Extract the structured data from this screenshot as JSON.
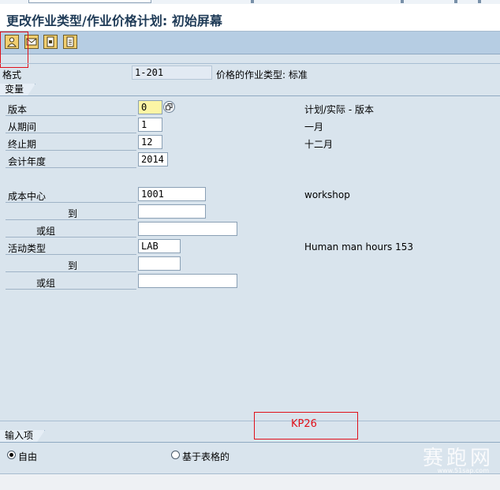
{
  "window": {
    "title": "更改作业类型/作业价格计划: 初始屏幕"
  },
  "toolbar": {
    "icons": [
      "person-icon",
      "envelope-icon",
      "document-icon",
      "document-list-icon"
    ]
  },
  "layout": {
    "label": "格式",
    "value": "1-201",
    "description": "价格的作业类型: 标准"
  },
  "variables": {
    "group_label": "变量",
    "version": {
      "label": "版本",
      "value": "0",
      "description": "计划/实际 - 版本"
    },
    "from_period": {
      "label": "从期间",
      "value": "1",
      "description": "一月"
    },
    "to_period": {
      "label": "终止期",
      "value": "12",
      "description": "十二月"
    },
    "fiscal_year": {
      "label": "会计年度",
      "value": "2014"
    },
    "cost_center": {
      "label": "成本中心",
      "value": "1001",
      "description": "workshop",
      "to_label": "到",
      "to_value": "",
      "or_group_label": "或组",
      "or_group_value": ""
    },
    "activity_type": {
      "label": "活动类型",
      "value": "LAB",
      "description": "Human man hours 153",
      "to_label": "到",
      "to_value": "",
      "or_group_label": "或组",
      "or_group_value": ""
    }
  },
  "annotation": {
    "text": "KP26"
  },
  "input": {
    "group_label": "输入项",
    "free_label": "自由",
    "form_based_label": "基于表格的",
    "selected": "free"
  },
  "watermark": {
    "text": "赛跑网",
    "sub": "www.51sap.com"
  },
  "colors": {
    "background": "#d9e4ed",
    "toolbar": "#b6cde3",
    "title": "#1f3b57",
    "annotation": "#e0101a",
    "focus_field": "#fcf5a5"
  }
}
